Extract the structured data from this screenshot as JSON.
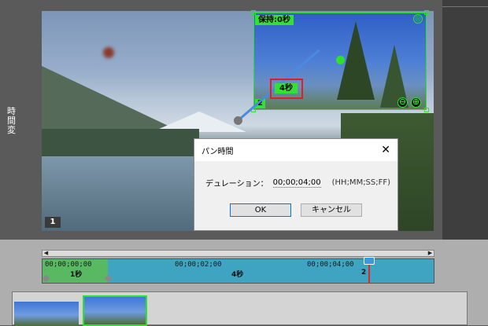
{
  "left_panel": {
    "text_line1": "時間",
    "text_line2": "変"
  },
  "preview": {
    "frame_number": "1",
    "hold_label": "保持:0秒",
    "keyframe_time_label": "4秒",
    "region_number": "2",
    "zoom_out_icon": "⊖",
    "zoom_in_icon": "⊕",
    "center_icon": "◎"
  },
  "dialog": {
    "title": "パン時間",
    "close_icon": "✕",
    "duration_label": "デュレーション：",
    "duration_value": "00;00;04;00",
    "duration_format": "(HH;MM;SS;FF)",
    "ok_label": "OK",
    "cancel_label": "キャンセル"
  },
  "timeline": {
    "timecodes": [
      "00;00;00;00",
      "00;00;02;00",
      "00;00;04;00"
    ],
    "keyframe_labels": [
      "1秒",
      "4秒",
      "2"
    ],
    "scroll_left_icon": "◀",
    "scroll_right_icon": "▶"
  },
  "colors": {
    "accent_green": "#2fe02f",
    "playhead_red": "#e02828",
    "ruler_blue": "#3fa3c2"
  }
}
